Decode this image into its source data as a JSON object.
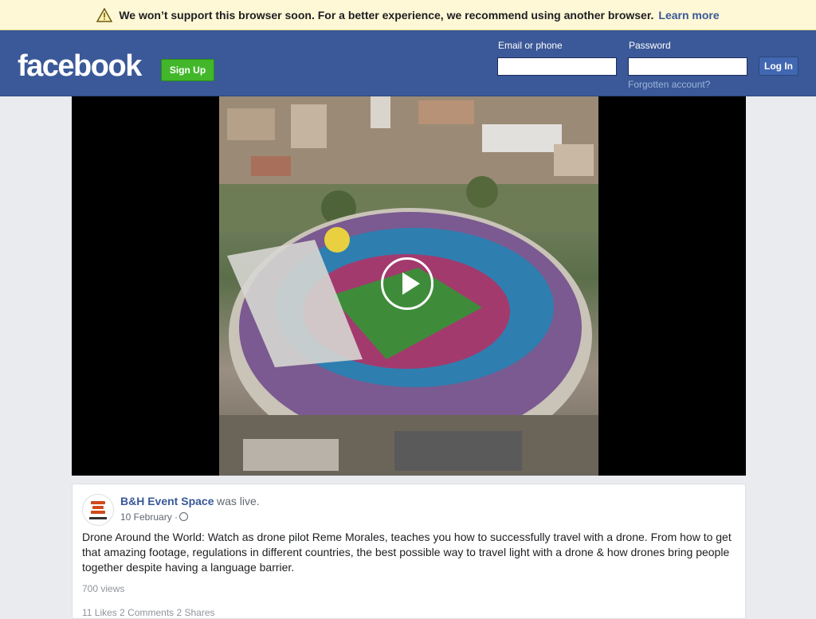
{
  "banner": {
    "icon": "warning-icon",
    "message": "We won’t support this browser soon. For a better experience, we recommend using another browser.",
    "link": "Learn more"
  },
  "header": {
    "logo": "facebook",
    "signup": "Sign Up",
    "email_label": "Email or phone",
    "email_value": "",
    "password_label": "Password",
    "password_value": "",
    "login": "Log In",
    "forgot": "Forgotten account?",
    "bg_color": "#3b5998"
  },
  "video": {
    "play_icon": "play-icon"
  },
  "post": {
    "page_name": "B&H Event Space",
    "activity": "was live.",
    "date": "10 February ·",
    "privacy_icon": "globe-icon",
    "text": "Drone Around the World: Watch as drone pilot Reme Morales, teaches you how to successfully travel with a drone. From how to get that amazing footage, regulations in different countries, the best possible way to travel light with a drone & how drones bring people together despite having a language barrier.",
    "views": "700 views",
    "stats": "11 Likes 2 Comments 2 Shares"
  }
}
